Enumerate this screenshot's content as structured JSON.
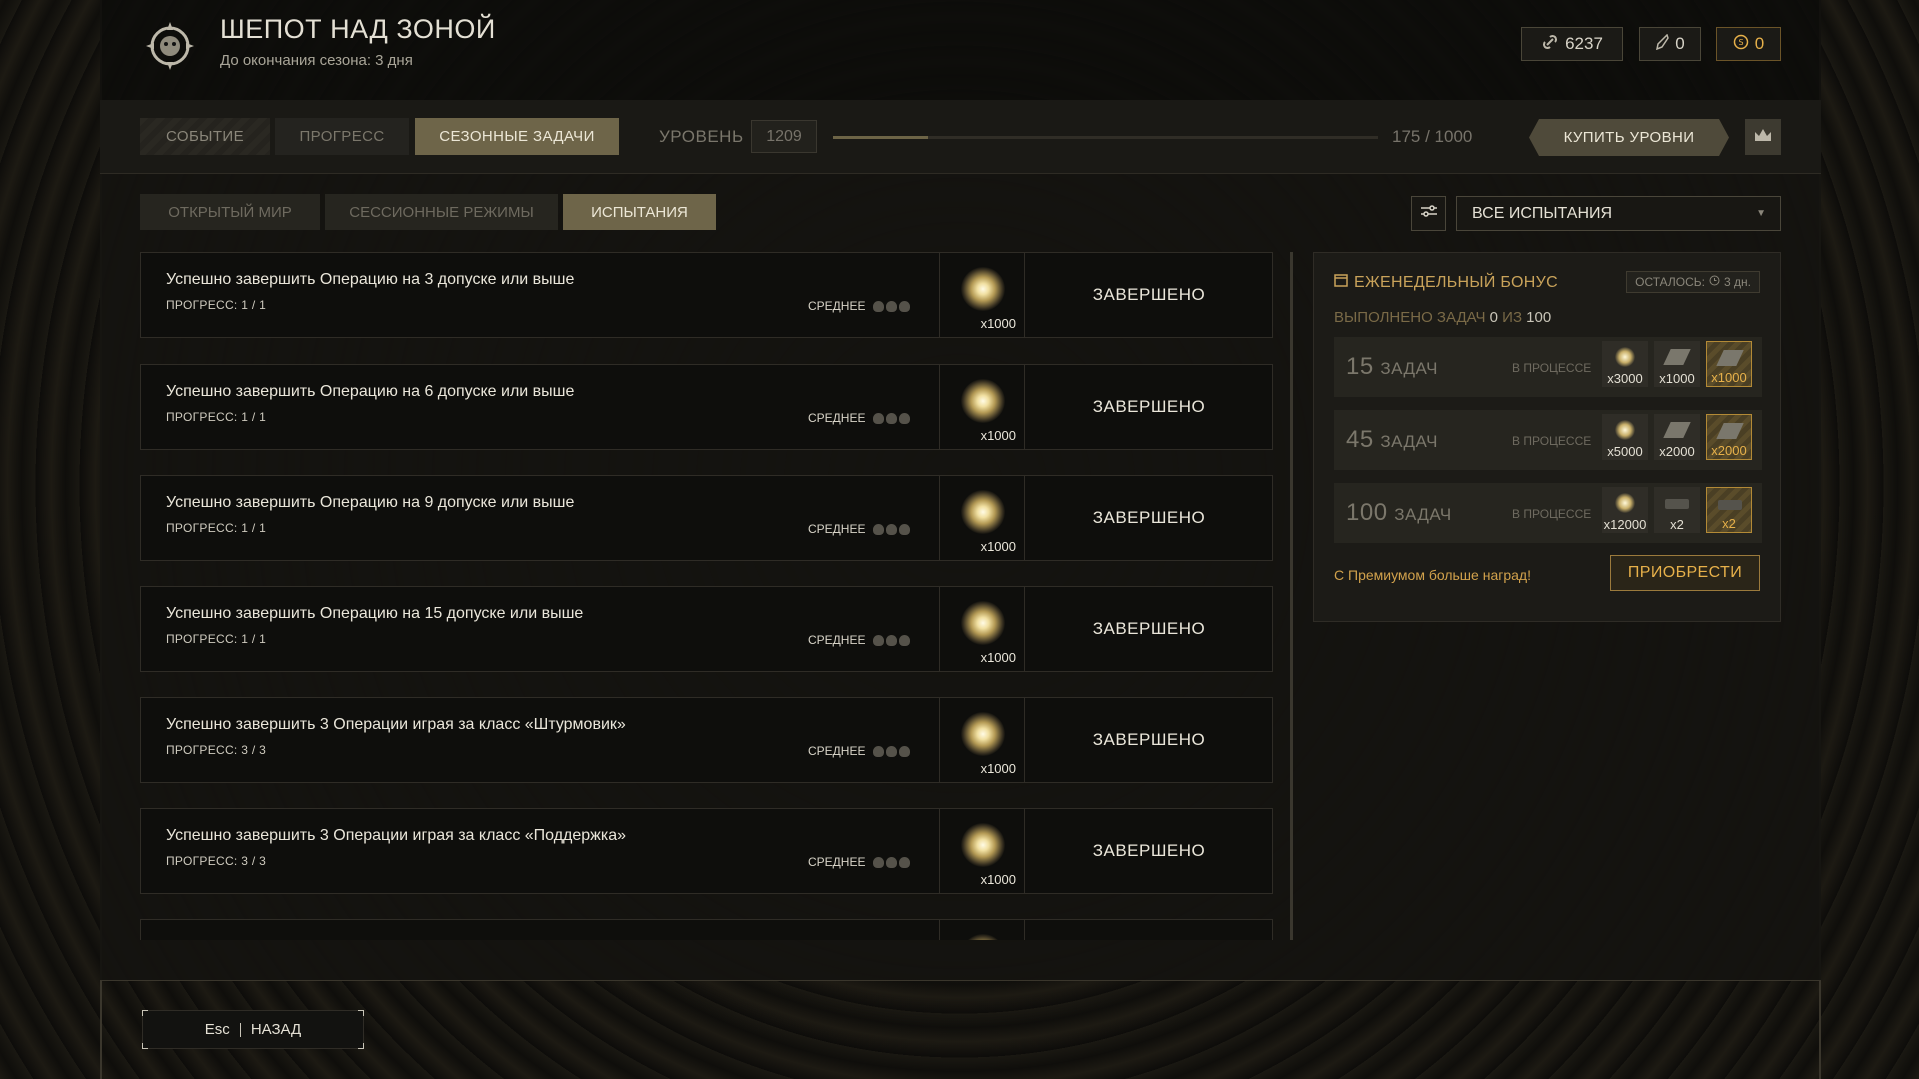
{
  "header": {
    "title": "ШЕПОТ НАД ЗОНОЙ",
    "subtitle": "До окончания сезона: 3 дня",
    "currencies": [
      {
        "icon": "chain-link-icon",
        "value": "6237"
      },
      {
        "icon": "feather-icon",
        "value": "0"
      },
      {
        "icon": "coin-icon",
        "value": "0",
        "color": "#e7b14a"
      }
    ]
  },
  "tabs": [
    {
      "label": "СОБЫТИЕ"
    },
    {
      "label": "ПРОГРЕСС"
    },
    {
      "label": "СЕЗОННЫЕ ЗАДАЧИ",
      "active": true
    }
  ],
  "level": {
    "label": "УРОВЕНЬ",
    "value": "1209",
    "progress_text": "175 / 1000",
    "progress_fraction": 0.175
  },
  "buy_levels_label": "КУПИТЬ УРОВНИ",
  "subtabs": [
    {
      "label": "ОТКРЫТЫЙ МИР"
    },
    {
      "label": "СЕССИОННЫЕ РЕЖИМЫ"
    },
    {
      "label": "ИСПЫТАНИЯ",
      "active": true
    }
  ],
  "filter": {
    "selected": "ВСЕ ИСПЫТАНИЯ"
  },
  "tasks": [
    {
      "name": "Успешно завершить Операцию на 3 допуске или выше",
      "progress": "ПРОГРЕСС: 1 / 1",
      "difficulty": "СРЕДНЕЕ",
      "reward_qty": "x1000",
      "status": "ЗАВЕРШЕНО"
    },
    {
      "name": "Успешно завершить Операцию на 6 допуске или выше",
      "progress": "ПРОГРЕСС: 1 / 1",
      "difficulty": "СРЕДНЕЕ",
      "reward_qty": "x1000",
      "status": "ЗАВЕРШЕНО"
    },
    {
      "name": "Успешно завершить Операцию на 9 допуске или выше",
      "progress": "ПРОГРЕСС: 1 / 1",
      "difficulty": "СРЕДНЕЕ",
      "reward_qty": "x1000",
      "status": "ЗАВЕРШЕНО"
    },
    {
      "name": "Успешно завершить Операцию на 15 допуске или выше",
      "progress": "ПРОГРЕСС: 1 / 1",
      "difficulty": "СРЕДНЕЕ",
      "reward_qty": "x1000",
      "status": "ЗАВЕРШЕНО"
    },
    {
      "name": "Успешно завершить 3 Операции играя за класс «Штурмовик»",
      "progress": "ПРОГРЕСС: 3 / 3",
      "difficulty": "СРЕДНЕЕ",
      "reward_qty": "x1000",
      "status": "ЗАВЕРШЕНО"
    },
    {
      "name": "Успешно завершить 3 Операции играя за класс «Поддержка»",
      "progress": "ПРОГРЕСС: 3 / 3",
      "difficulty": "СРЕДНЕЕ",
      "reward_qty": "x1000",
      "status": "ЗАВЕРШЕНО"
    }
  ],
  "weekly_bonus": {
    "title": "ЕЖЕНЕДЕЛЬНЫЙ БОНУС",
    "time_left_label": "ОСТАЛОСЬ:",
    "time_left_value": "3 дн.",
    "done_prefix": "ВЫПОЛНЕНО ЗАДАЧ",
    "done_count": "0",
    "done_mid": "ИЗ",
    "done_total": "100",
    "tiers": [
      {
        "count": "15",
        "unit": "ЗАДАЧ",
        "status": "В ПРОЦЕССЕ",
        "rewards": [
          {
            "type": "orb",
            "qty": "x3000"
          },
          {
            "type": "card",
            "qty": "x1000"
          },
          {
            "type": "card",
            "qty": "x1000",
            "premium": true
          }
        ]
      },
      {
        "count": "45",
        "unit": "ЗАДАЧ",
        "status": "В ПРОЦЕССЕ",
        "rewards": [
          {
            "type": "orb",
            "qty": "x5000"
          },
          {
            "type": "card",
            "qty": "x2000"
          },
          {
            "type": "card",
            "qty": "x2000",
            "premium": true
          }
        ]
      },
      {
        "count": "100",
        "unit": "ЗАДАЧ",
        "status": "В ПРОЦЕССЕ",
        "rewards": [
          {
            "type": "orb",
            "qty": "x12000"
          },
          {
            "type": "box",
            "qty": "x2"
          },
          {
            "type": "box",
            "qty": "x2",
            "premium": true
          }
        ]
      }
    ],
    "premium_text": "С Премиумом больше наград!",
    "buy_label": "ПРИОБРЕСТИ"
  },
  "footer": {
    "key": "Esc",
    "label": "НАЗАД"
  }
}
